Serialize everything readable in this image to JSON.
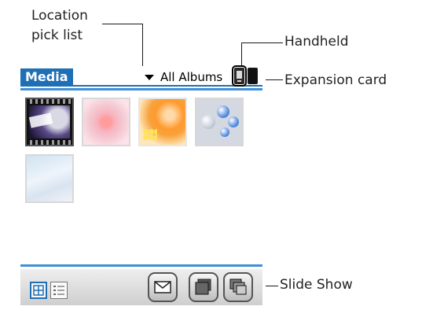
{
  "callouts": {
    "location_pick_list_line1": "Location",
    "location_pick_list_line2": "pick list",
    "handheld": "Handheld",
    "expansion_card": "Expansion card",
    "slide_show": "Slide Show"
  },
  "app": {
    "title": "Media",
    "location": "All Albums",
    "accent_color": "#1f6fb4"
  },
  "thumbnails": [
    {
      "name": "marias-story"
    },
    {
      "name": "pink-rose"
    },
    {
      "name": "orange-flowers"
    },
    {
      "name": "blue-bubbles"
    },
    {
      "name": "light-blue-abstract"
    }
  ]
}
